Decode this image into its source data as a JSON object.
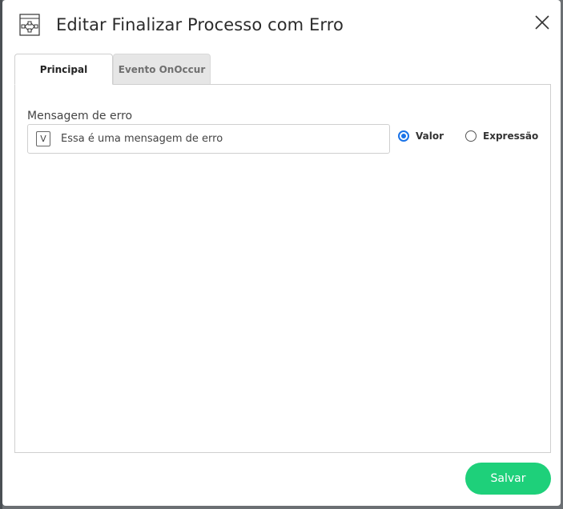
{
  "dialog": {
    "title": "Editar Finalizar Processo com Erro",
    "title_icon": "process-flow-icon",
    "close_icon": "close-icon"
  },
  "tabs": [
    {
      "label": "Principal",
      "active": true
    },
    {
      "label": "Evento OnOccur",
      "active": false
    }
  ],
  "form": {
    "error_message": {
      "label": "Mensagem de erro",
      "type_badge": "V",
      "value": "Essa é uma mensagem de erro"
    },
    "mode_options": [
      {
        "label": "Valor",
        "checked": true
      },
      {
        "label": "Expressão",
        "checked": false
      }
    ]
  },
  "footer": {
    "save_label": "Salvar"
  },
  "colors": {
    "save_button": "#1ed07a",
    "radio_selected": "#1a73e8"
  }
}
